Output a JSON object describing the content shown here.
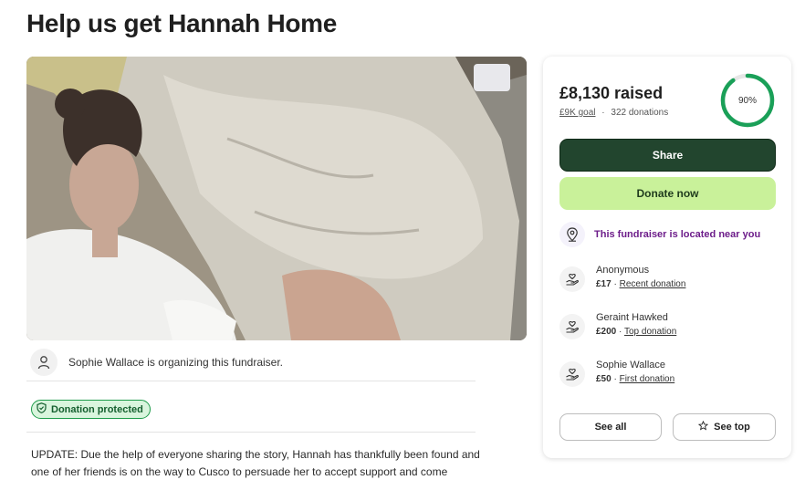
{
  "page": {
    "title": "Help us get Hannah Home"
  },
  "organizer": {
    "text": "Sophie Wallace is organizing this fundraiser."
  },
  "badge": {
    "label": "Donation protected"
  },
  "story": {
    "text": "UPDATE: Due the help of everyone sharing the story, Hannah has thankfully been found and one of her friends is on the way to Cusco to persuade her to accept support and come"
  },
  "card": {
    "raised": "£8,130 raised",
    "goal": "£9K goal",
    "separator": "·",
    "donations_count": "322 donations",
    "progress_label": "90%",
    "progress": 0.9,
    "share_label": "Share",
    "donate_label": "Donate now",
    "location_text": "This fundraiser is located near you",
    "donations": [
      {
        "name": "Anonymous",
        "amount": "£17",
        "sep": "·",
        "tag": "Recent donation"
      },
      {
        "name": "Geraint Hawked",
        "amount": "£200",
        "sep": "·",
        "tag": "Top donation"
      },
      {
        "name": "Sophie Wallace",
        "amount": "£50",
        "sep": "·",
        "tag": "First donation"
      }
    ],
    "see_all_label": "See all",
    "see_top_label": "See top"
  },
  "colors": {
    "share": "#22452e",
    "donate": "#c9f19a",
    "ring": "#1aa058",
    "location": "#6d1d8a"
  },
  "icons": [
    "person-icon",
    "shield-icon",
    "location-pin-icon",
    "donation-hand-icon",
    "star-icon"
  ]
}
